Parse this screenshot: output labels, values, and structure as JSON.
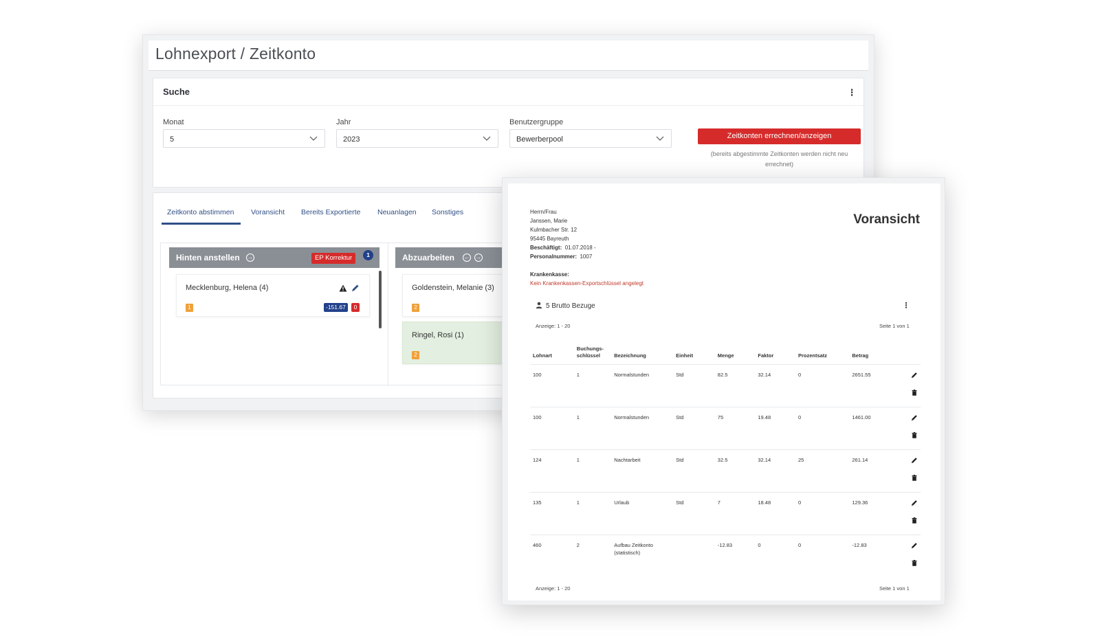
{
  "back": {
    "page_title": "Lohnexport / Zeitkonto",
    "search": {
      "title": "Suche",
      "fields": [
        {
          "label": "Monat",
          "value": "5"
        },
        {
          "label": "Jahr",
          "value": "2023"
        },
        {
          "label": "Benutzergruppe",
          "value": "Bewerberpool"
        }
      ],
      "button_label": "Zeitkonten errechnen/anzeigen",
      "button_note": "(bereits abgestimmte Zeitkonten werden nicht neu errechnet)"
    },
    "tabs": [
      "Zeitkonto abstimmen",
      "Voransicht",
      "Bereits Exportierte",
      "Neuanlagen",
      "Sonstiges"
    ],
    "columns": [
      {
        "title": "Hinten anstellen",
        "badge": "EP Korrektur",
        "count": "1",
        "cards": [
          {
            "name": "Mecklenburg, Helena (4)",
            "tag": "1",
            "amount": "-151.67",
            "errors": "0"
          }
        ]
      },
      {
        "title": "Abzuarbeiten",
        "cards": [
          {
            "name": "Goldenstein, Melanie (3)",
            "tag": "2"
          },
          {
            "name": "Ringel, Rosi (1)",
            "tag": "2"
          }
        ]
      }
    ],
    "colors": {
      "accent": "#d62b2b",
      "primary": "#22418a",
      "tag": "#f0a13a",
      "column_head": "#8a8f96"
    }
  },
  "front": {
    "title": "Voransicht",
    "address": {
      "salutation": "Herrn/Frau",
      "name": "Janssen, Marie",
      "street": "Kulmbacher Str. 12",
      "city": "95445 Bayreuth",
      "employed_label": "Beschäftigt:",
      "employed_value": "01.07.2018 -",
      "personnel_label": "Personalnummer:",
      "personnel_value": "1007",
      "insurance_label": "Krankenkasse:",
      "insurance_warning": "Kein Krankenkassen-Exportschlüssel angelegt"
    },
    "section_title": "5 Brutto Bezuge",
    "pager_left": "Anzeige: 1 - 20",
    "pager_right": "Seite 1 von 1",
    "table": {
      "headers": [
        "Lohnart",
        "Buchungs-schlüssel",
        "Bezeichnung",
        "Einheit",
        "Menge",
        "Faktor",
        "Prozentsatz",
        "Betrag"
      ],
      "rows": [
        [
          "100",
          "1",
          "Normalstunden",
          "Std",
          "82.5",
          "32.14",
          "0",
          "2651.55"
        ],
        [
          "100",
          "1",
          "Normalstunden",
          "Std",
          "75",
          "19.48",
          "0",
          "1461.00"
        ],
        [
          "124",
          "1",
          "Nachtarbeit",
          "Std",
          "32.5",
          "32.14",
          "25",
          "261.14"
        ],
        [
          "135",
          "1",
          "Urlaub",
          "Std",
          "7",
          "18.48",
          "0",
          "129.36"
        ],
        [
          "460",
          "2",
          "Aufbau Zeitkonto (statistisch)",
          "",
          "-12.83",
          "0",
          "0",
          "-12.83"
        ]
      ]
    }
  }
}
